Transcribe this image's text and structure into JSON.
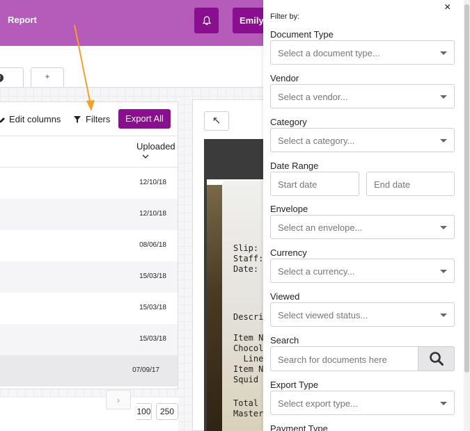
{
  "header": {
    "brand": "Report",
    "user_label": "Emily T"
  },
  "tabs": [
    {
      "icon": "close-icon",
      "label": "×"
    },
    {
      "label": "+"
    }
  ],
  "toolbar": {
    "edit_columns": "Edit columns",
    "filters": "Filters",
    "export_all": "Export All"
  },
  "table": {
    "column_header": "Uploaded",
    "rows": [
      {
        "uploaded": "12/10/18"
      },
      {
        "uploaded": "12/10/18"
      },
      {
        "uploaded": "08/06/18"
      },
      {
        "uploaded": "15/03/18"
      },
      {
        "uploaded": "15/03/18"
      },
      {
        "uploaded": "15/03/18"
      },
      {
        "uploaded": "07/09/17"
      }
    ]
  },
  "pagination": {
    "next": "›",
    "sizes": [
      "100",
      "250"
    ]
  },
  "viewer": {
    "expand": "↖",
    "receipt_lines": [
      "Slip:",
      "Staff:",
      "Date:",
      "Descrip",
      "Item No",
      "Chocola",
      "  Line",
      "Item No",
      "Squid I",
      "Total $",
      "Master C"
    ]
  },
  "filter": {
    "close": "×",
    "title": "Filter by:",
    "document_type": {
      "label": "Document Type",
      "placeholder": "Select a document type..."
    },
    "vendor": {
      "label": "Vendor",
      "placeholder": "Select a vendor..."
    },
    "category": {
      "label": "Category",
      "placeholder": "Select a category..."
    },
    "date_range": {
      "label": "Date Range",
      "start": "Start date",
      "end": "End date"
    },
    "envelope": {
      "label": "Envelope",
      "placeholder": "Select an envelope..."
    },
    "currency": {
      "label": "Currency",
      "placeholder": "Select a currency..."
    },
    "viewed": {
      "label": "Viewed",
      "placeholder": "Select viewed status..."
    },
    "search": {
      "label": "Search",
      "placeholder": "Search for documents here"
    },
    "export_type": {
      "label": "Export Type",
      "placeholder": "Select export type..."
    },
    "payment_type": {
      "label": "Payment Type"
    }
  },
  "colors": {
    "header_bg": "#b55bba",
    "accent": "#8a0f90",
    "annotation": "#f5a023"
  }
}
